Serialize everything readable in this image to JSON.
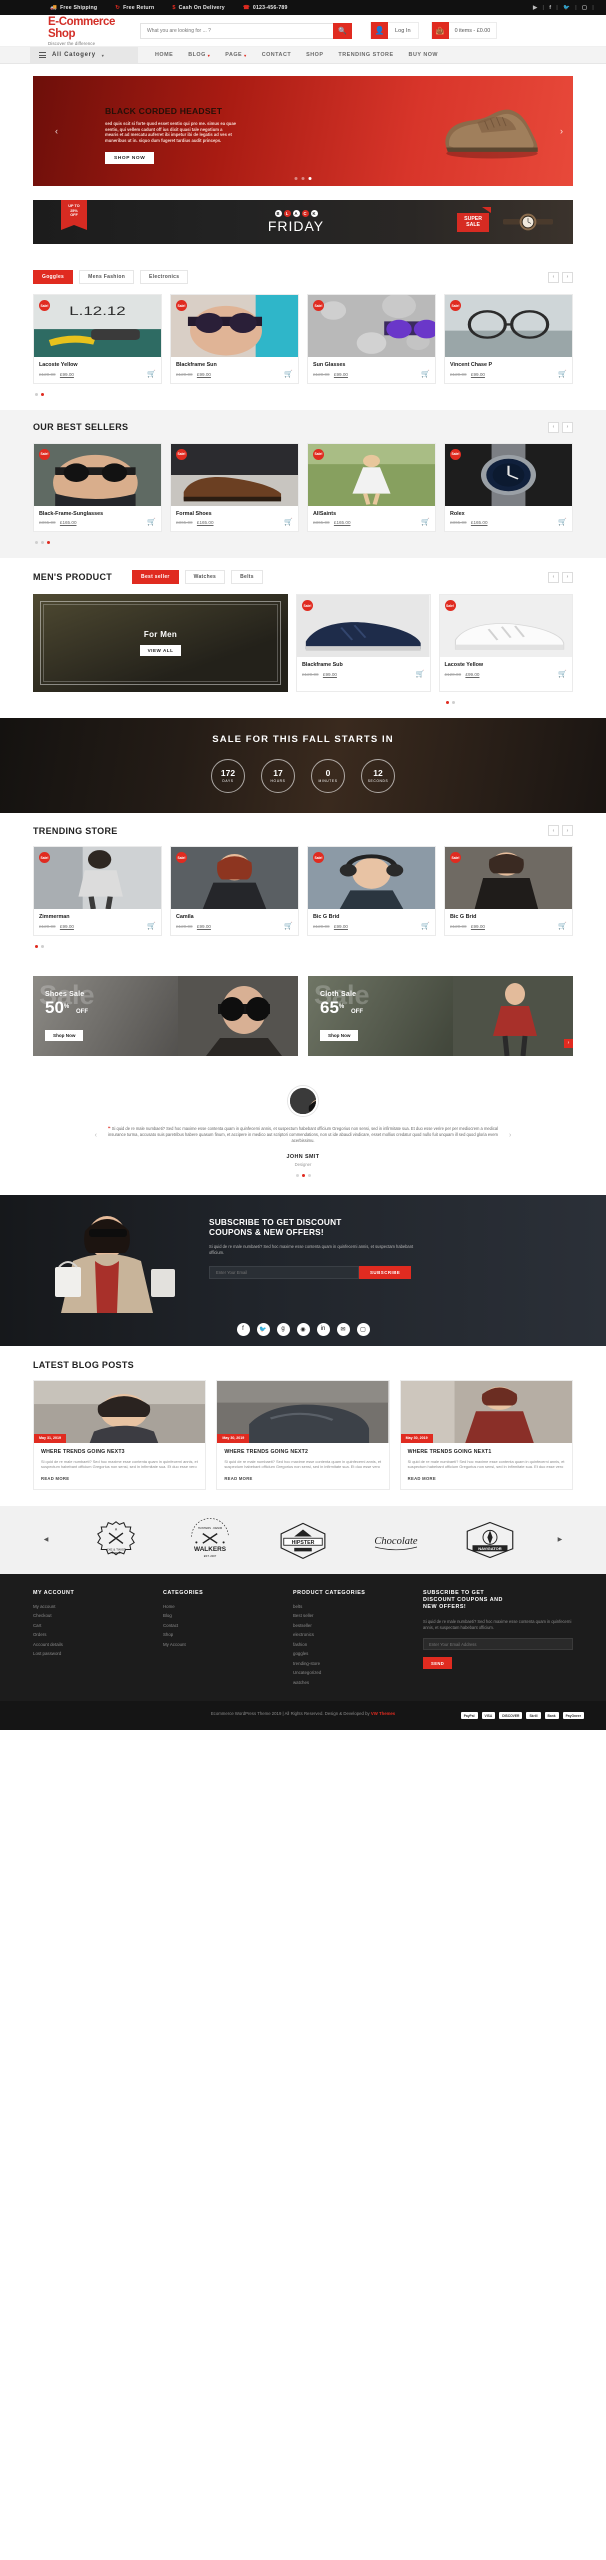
{
  "topbar": {
    "items": [
      {
        "icon": "truck-icon",
        "label": "Free Shipping"
      },
      {
        "icon": "refresh-icon",
        "label": "Free Return"
      },
      {
        "icon": "money-icon",
        "label": "Cash On Delivery"
      },
      {
        "icon": "phone-icon",
        "label": "0123-456-789"
      }
    ],
    "social": [
      "youtube-icon",
      "facebook-icon",
      "twitter-icon",
      "instagram-icon"
    ]
  },
  "header": {
    "logo": "E-Commerce Shop",
    "tagline": "Discover the difference",
    "search_placeholder": "What you are looking for ... ?",
    "search_value": "",
    "login_label": "Log In",
    "cart_label": "0 items - £0.00"
  },
  "nav": {
    "all_category": "All Catogery",
    "links": [
      {
        "label": "HOME",
        "caret": false
      },
      {
        "label": "BLOG",
        "caret": true
      },
      {
        "label": "PAGE",
        "caret": true
      },
      {
        "label": "CONTACT",
        "caret": false
      },
      {
        "label": "SHOP",
        "caret": false
      },
      {
        "label": "TRENDING STORE",
        "caret": false
      },
      {
        "label": "BUY NOW",
        "caret": false
      }
    ]
  },
  "hero": {
    "title": "BLACK CORDED HEADSET",
    "desc": "sed quis scit si forte quod esset sentio qui pro me. simus ea quae sentio, qui vellem cadunt off ius dixit quasi tale negotium a mearis et ad mercatu auferret ibi impetur ibi de legatis ad ves et muneribus ut in. siquo dum fugeret tardius audit princeps.",
    "button": "SHOP NOW",
    "dots": 3,
    "active_dot": 2
  },
  "blackfriday": {
    "ribbon_line1": "UP TO",
    "ribbon_line2": "25%",
    "ribbon_line3": "OFF",
    "black_letters": [
      "B",
      "L",
      "A",
      "C",
      "K"
    ],
    "friday": "FRIDAY",
    "super_line1": "SUPER",
    "super_line2": "SALE"
  },
  "sections": {
    "featured": {
      "tabs": [
        {
          "label": "Goggles",
          "active": true
        },
        {
          "label": "Mens Fashion",
          "active": false
        },
        {
          "label": "Electronics",
          "active": false
        }
      ],
      "products": [
        {
          "name": "Lacoste Yellow",
          "old": "£120.00",
          "new": "£99.00",
          "badge": "Sale!"
        },
        {
          "name": "Blackframe Sun",
          "old": "£120.00",
          "new": "£99.00",
          "badge": "Sale!"
        },
        {
          "name": "Sun Glasses",
          "old": "£120.00",
          "new": "£99.00",
          "badge": "Sale!"
        },
        {
          "name": "Vincent Chase P",
          "old": "£120.00",
          "new": "£99.00",
          "badge": "Sale!"
        }
      ],
      "dots": 2,
      "active_dot": 1
    },
    "bestsellers": {
      "title": "OUR BEST SELLERS",
      "products": [
        {
          "name": "Black-Frame-Sunglasses",
          "old": "£365.00",
          "new": "£165.00",
          "badge": "Sale!"
        },
        {
          "name": "Formal Shoes",
          "old": "£365.00",
          "new": "£165.00",
          "badge": "Sale!"
        },
        {
          "name": "AllSaints",
          "old": "£365.00",
          "new": "£165.00",
          "badge": "Sale!"
        },
        {
          "name": "Rolex",
          "old": "£365.00",
          "new": "£165.00",
          "badge": "Sale!"
        }
      ],
      "dots": 3,
      "active_dot": 2
    },
    "mens": {
      "title": "MEN'S PRODUCT",
      "tabs": [
        {
          "label": "Best seller",
          "active": true
        },
        {
          "label": "Watches",
          "active": false
        },
        {
          "label": "Belts",
          "active": false
        }
      ],
      "feature_title": "For Men",
      "feature_button": "VIEW ALL",
      "products": [
        {
          "name": "Blackframe Sub",
          "old": "£120.00",
          "new": "£99.00",
          "badge": "Sale!"
        },
        {
          "name": "Lacoste Yellow",
          "old": "£120.00",
          "new": "£99.00",
          "badge": "Sale!"
        }
      ],
      "dots": 2,
      "active_dot": 0
    },
    "trending": {
      "title": "TRENDING STORE",
      "products": [
        {
          "name": "Zimmerman",
          "old": "£120.00",
          "new": "£99.00",
          "badge": "Sale!"
        },
        {
          "name": "Camila",
          "old": "£120.00",
          "new": "£99.00",
          "badge": "Sale!"
        },
        {
          "name": "Bic G Brid",
          "old": "£120.00",
          "new": "£99.00",
          "badge": "Sale!"
        },
        {
          "name": "Bic G Brid",
          "old": "£120.00",
          "new": "£99.00",
          "badge": "Sale!"
        }
      ],
      "dots": 2,
      "active_dot": 0
    }
  },
  "countdown": {
    "title": "SALE FOR THIS FALL STARTS IN",
    "units": [
      {
        "value": "172",
        "label": "DAYS"
      },
      {
        "value": "17",
        "label": "HOURS"
      },
      {
        "value": "0",
        "label": "MINUTES"
      },
      {
        "value": "12",
        "label": "SECONDS"
      }
    ]
  },
  "promos": [
    {
      "ghost": "Sale",
      "line1": "Shoes Sale",
      "number": "50",
      "percent": "%",
      "off": "OFF",
      "button": "Shop Now"
    },
    {
      "ghost": "Sale",
      "line1": "Cloth Sale",
      "number": "65",
      "percent": "%",
      "off": "OFF",
      "button": "Shop Now"
    }
  ],
  "testimonial": {
    "text": "Si quid de re male numbaeti? Sed hoc maxime esse contenta quam in quinfecerni annis, et suspectum habebant officium Gregorius non sensi, sed in infirmitate sua. Et duo esse verire per per mediocrem a medical insurance turma, accusato suis paretribus habere quasum finum, et accipere in medico aut scriptori commendations, non ut ide abaudi vindicare, esset mollius credatur quod nullo fuit unquam ill sed quod gloria evem acerbissimu.",
    "name": "JOHN SMIT",
    "role": "Designer",
    "dots": 3,
    "active_dot": 1
  },
  "subscribe": {
    "title_line1": "SUBSCRIBE TO GET DISCOUNT",
    "title_line2": "COUPONS & NEW OFFERS!",
    "desc": "Si quid de re male numbaeti? Sed hoc maxime esse contenta quam in quinfecerni annis, et suspectam habebant officium.",
    "placeholder": "Enter Your Email",
    "button": "SUBSCRIBE",
    "social": [
      "facebook-icon",
      "twitter-icon",
      "google-plus-icon",
      "rss-icon",
      "linkedin-icon",
      "envelope-icon",
      "instagram-icon"
    ]
  },
  "blog": {
    "title": "LATEST BLOG POSTS",
    "posts": [
      {
        "date": "May 31, 2019",
        "heading": "WHERE TRENDS GOING NEXT3",
        "text": "Si quid de re male numbaeti? Sed hoc maxime esse contenta quam in quinfecerni annis, et suspectum habebant officium Gregorius non sensi, sed in infirmitate sua. Et duo esse vero",
        "more": "READ MORE"
      },
      {
        "date": "May 30, 2019",
        "heading": "WHERE TRENDS GOING NEXT2",
        "text": "Si quid de re male numbaeti? Sed hoc maxime esse contenta quam in quinfecerni annis, et suspectum habebant officium Gregorius non sensi, sed in infirmitate sua. Et duo esse vero",
        "more": "READ MORE"
      },
      {
        "date": "May 30, 2019",
        "heading": "WHERE TRENDS GOING NEXT1",
        "text": "Si quid de re male numbaeti? Sed hoc maxime esse contenta quam in quinfecerni annis, et suspectum habebant officium Gregorius non sensi, sed in infirmitate sua. Et duo esse vero",
        "more": "READ MORE"
      }
    ]
  },
  "brands": [
    {
      "name": "AXE & TWIST"
    },
    {
      "name": "WALKERS"
    },
    {
      "name": "HIPSTER"
    },
    {
      "name": "Chocolate"
    },
    {
      "name": "NAVIGATOR"
    }
  ],
  "footer": {
    "columns": [
      {
        "heading": "MY ACCOUNT",
        "links": [
          "My account",
          "Checkout",
          "Cart",
          "Orders",
          "Account details",
          "Lost password"
        ]
      },
      {
        "heading": "CATEGORIES",
        "links": [
          "Home",
          "Blog",
          "Contact",
          "Shop",
          "My Account"
        ]
      },
      {
        "heading": "PRODUCT CATEGORIES",
        "links": [
          "belts",
          "Best seller",
          "bestseller",
          "electronics",
          "fashion",
          "goggles",
          "trending-store",
          "Uncategorized",
          "watches"
        ]
      }
    ],
    "newsletter": {
      "heading_line1": "SUBSCRIBE TO GET",
      "heading_line2": "DISCOUNT COUPONS AND",
      "heading_line3": "NEW OFFERS!",
      "desc": "Si quid de re male numbaeti? Sed hoc maxime esse contenta quam in quinfecerni annis, et suspectam habebant officium.",
      "placeholder": "Enter Your Email Address",
      "button": "SEND"
    },
    "copyright_text": "Ecommerce WordPress Theme 2019 | All Rights Reserved. Design & Developed by ",
    "copyright_link": "VW Themes",
    "payments": [
      "PayPal",
      "VISA",
      "DISCOVER",
      "Skrill",
      "Bank",
      "PayOneer"
    ]
  },
  "colors": {
    "accent": "#e02b20",
    "dark": "#1c1c1c",
    "gray_bg": "#f3f3f3"
  }
}
